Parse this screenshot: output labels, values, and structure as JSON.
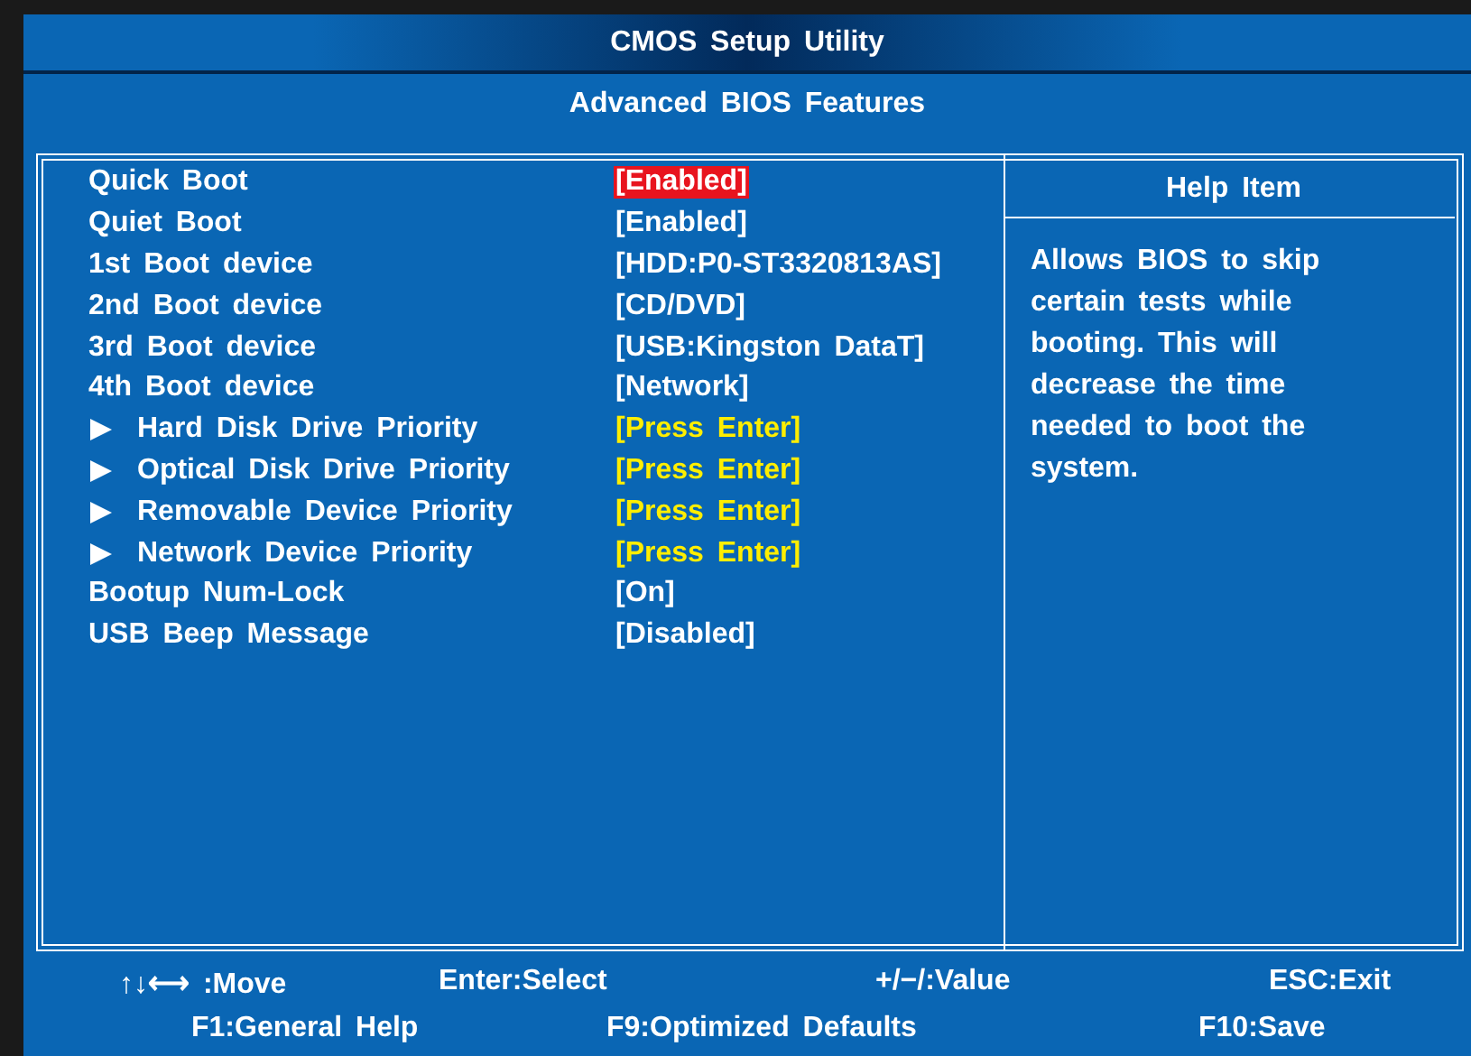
{
  "window": {
    "title": "CMOS Setup Utility"
  },
  "page_title": "Advanced BIOS Features",
  "settings": [
    {
      "kind": "setting",
      "label": "Quick Boot",
      "value": "[Enabled]",
      "selected": true
    },
    {
      "kind": "setting",
      "label": "Quiet Boot",
      "value": "[Enabled]",
      "selected": false
    },
    {
      "kind": "setting",
      "label": "1st Boot device",
      "value": "[HDD:P0-ST3320813AS]",
      "selected": false
    },
    {
      "kind": "setting",
      "label": "2nd Boot device",
      "value": "[CD/DVD]",
      "selected": false
    },
    {
      "kind": "setting",
      "label": "3rd Boot device",
      "value": "[USB:Kingston DataT]",
      "selected": false
    },
    {
      "kind": "setting",
      "label": "4th Boot device",
      "value": "[Network]",
      "selected": false
    },
    {
      "kind": "submenu",
      "label": "Hard Disk Drive Priority",
      "value": "[Press Enter]",
      "selected": false
    },
    {
      "kind": "submenu",
      "label": "Optical Disk Drive Priority",
      "value": "[Press Enter]",
      "selected": false
    },
    {
      "kind": "submenu",
      "label": "Removable Device Priority",
      "value": "[Press Enter]",
      "selected": false
    },
    {
      "kind": "submenu",
      "label": "Network Device Priority",
      "value": "[Press Enter]",
      "selected": false
    },
    {
      "kind": "setting",
      "label": "Bootup Num-Lock",
      "value": "[On]",
      "selected": false
    },
    {
      "kind": "setting",
      "label": "USB Beep Message",
      "value": "[Disabled]",
      "selected": false
    }
  ],
  "help": {
    "title": "Help Item",
    "text": "Allows BIOS to skip certain tests while booting. This will decrease the time needed to boot the system."
  },
  "key_legend": [
    [
      "↑↓⟷ :Move",
      "Enter:Select",
      "+/−/:Value",
      "ESC:Exit"
    ],
    [
      "F1:General Help",
      "F9:Optimized Defaults",
      "F10:Save"
    ]
  ]
}
